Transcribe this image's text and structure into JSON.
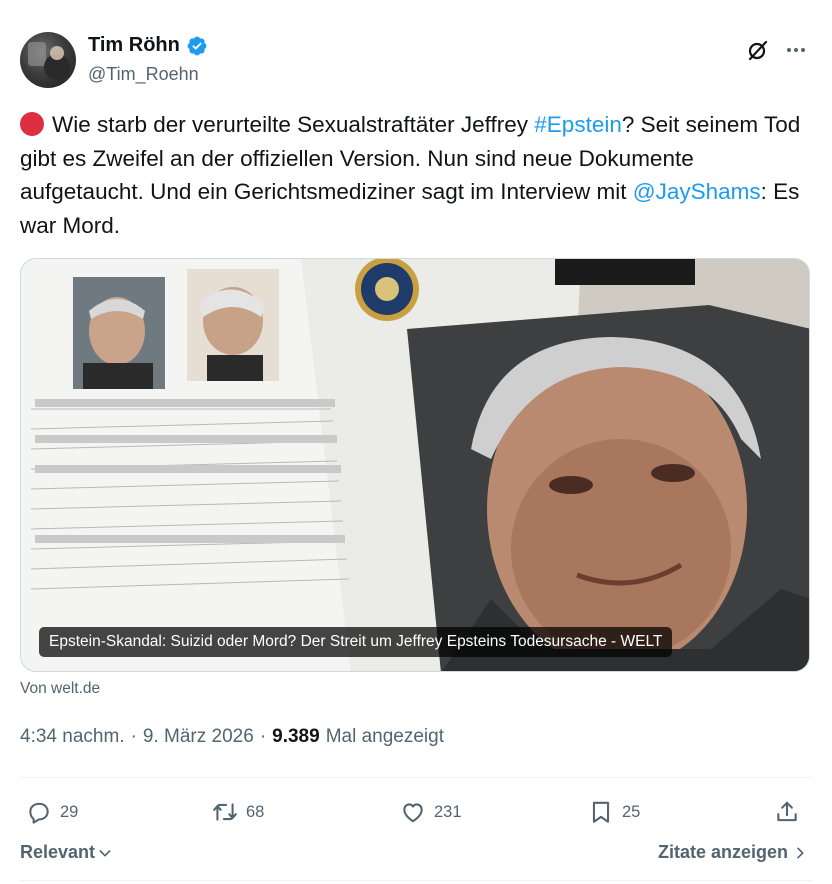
{
  "author": {
    "display_name": "Tim Röhn",
    "handle": "@Tim_Roehn",
    "verified": true
  },
  "tweet": {
    "text_segments": {
      "s1": "Wie starb der verurteilte Sexualstraftäter Jeffrey ",
      "hashtag": "#Epstein",
      "s2": "? Seit seinem Tod gibt es Zweifel an der offiziellen Version. Nun sind neue Dokumente aufgetaucht. Und ein Gerichtsmediziner sagt im Interview mit ",
      "mention": "@JayShams",
      "s3": ": Es war Mord."
    },
    "card": {
      "caption": "Epstein-Skandal: Suizid oder Mord? Der Streit um Jeffrey Epsteins Todesursache - WELT",
      "source": "Von welt.de"
    },
    "time": "4:34 nachm.",
    "date": "9. März 2026",
    "separator": "·",
    "views_count": "9.389",
    "views_label": "Mal angezeigt"
  },
  "actions": {
    "replies": "29",
    "reposts": "68",
    "likes": "231",
    "bookmarks": "25"
  },
  "footer": {
    "sort_label": "Relevant",
    "quotes_label": "Zitate anzeigen"
  },
  "colors": {
    "accent": "#1d9bf0",
    "text": "#0f1419",
    "muted": "#536471",
    "red_circle": "#dd2e44"
  },
  "icons": [
    "verified-badge-icon",
    "grok-icon",
    "more-icon",
    "reply-icon",
    "repost-icon",
    "like-icon",
    "bookmark-icon",
    "share-icon",
    "chevron-down-icon",
    "chevron-right-icon"
  ]
}
